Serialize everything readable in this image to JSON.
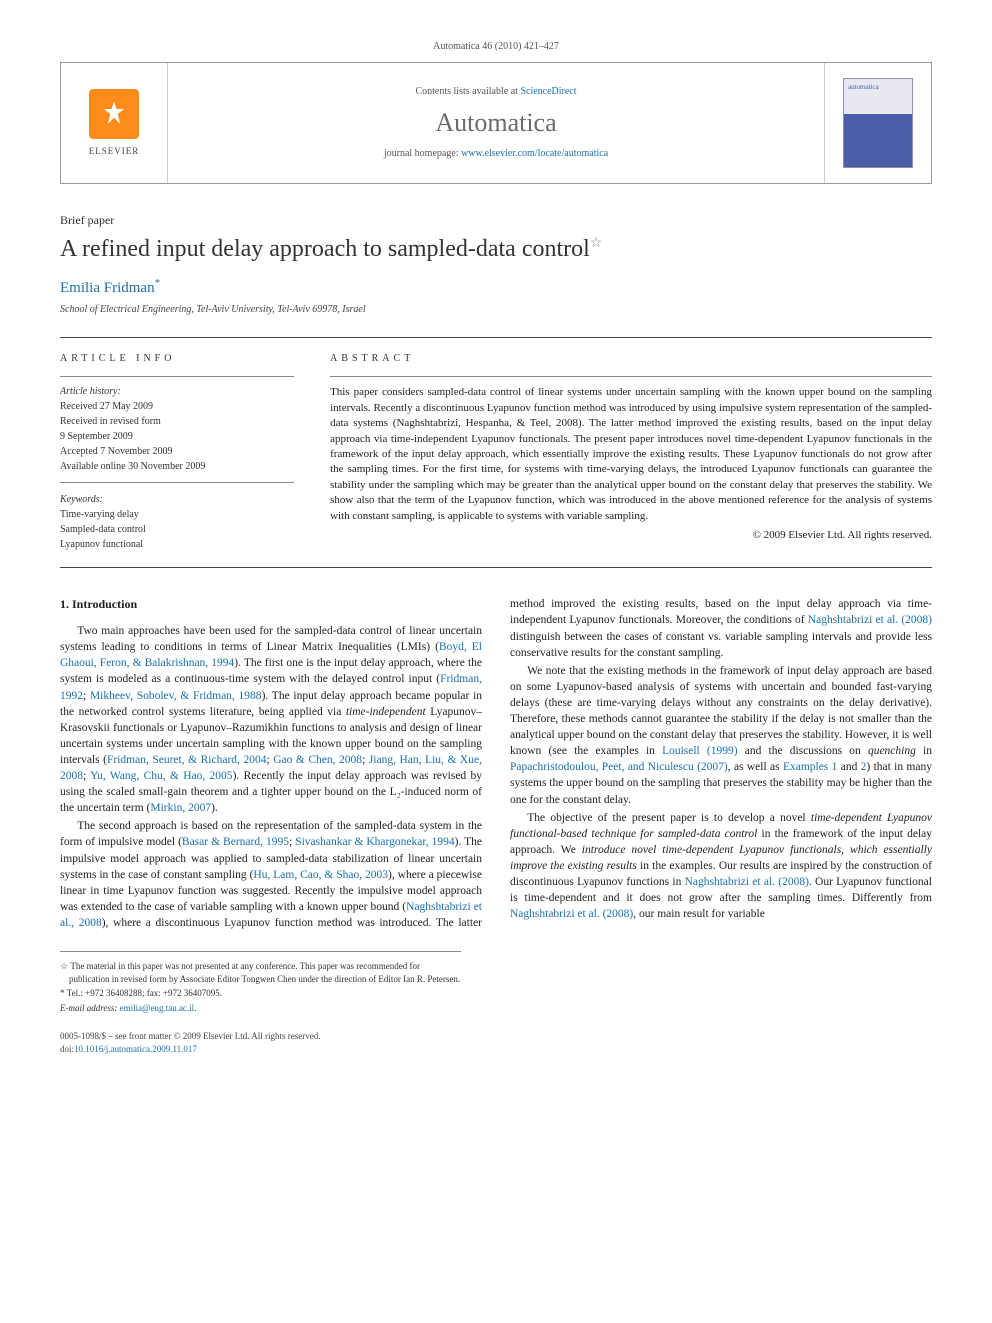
{
  "header": {
    "citation": "Automatica 46 (2010) 421–427"
  },
  "journal_box": {
    "publisher": "ELSEVIER",
    "contents_prefix": "Contents lists available at ",
    "contents_link": "ScienceDirect",
    "journal_name": "Automatica",
    "homepage_prefix": "journal homepage: ",
    "homepage_link": "www.elsevier.com/locate/automatica",
    "cover_label": "automatica"
  },
  "paper": {
    "type": "Brief paper",
    "title": "A refined input delay approach to sampled-data control",
    "title_marker": "☆",
    "author": "Emilia Fridman",
    "author_marker": "*",
    "affiliation": "School of Electrical Engineering, Tel-Aviv University, Tel-Aviv 69978, Israel"
  },
  "article_info": {
    "label": "ARTICLE INFO",
    "history_label": "Article history:",
    "history": [
      "Received 27 May 2009",
      "Received in revised form",
      "9 September 2009",
      "Accepted 7 November 2009",
      "Available online 30 November 2009"
    ],
    "keywords_label": "Keywords:",
    "keywords": [
      "Time-varying delay",
      "Sampled-data control",
      "Lyapunov functional"
    ]
  },
  "abstract": {
    "label": "ABSTRACT",
    "text": "This paper considers sampled-data control of linear systems under uncertain sampling with the known upper bound on the sampling intervals. Recently a discontinuous Lyapunov function method was introduced by using impulsive system representation of the sampled-data systems (Naghshtabrizi, Hespanha, & Teel, 2008). The latter method improved the existing results, based on the input delay approach via time-independent Lyapunov functionals. The present paper introduces novel time-dependent Lyapunov functionals in the framework of the input delay approach, which essentially improve the existing results. These Lyapunov functionals do not grow after the sampling times. For the first time, for systems with time-varying delays, the introduced Lyapunov functionals can guarantee the stability under the sampling which may be greater than the analytical upper bound on the constant delay that preserves the stability. We show also that the term of the Lyapunov function, which was introduced in the above mentioned reference for the analysis of systems with constant sampling, is applicable to systems with variable sampling.",
    "copyright": "© 2009 Elsevier Ltd. All rights reserved."
  },
  "body": {
    "section1_title": "1. Introduction",
    "p1a": "Two main approaches have been used for the sampled-data control of linear uncertain systems leading to conditions in terms of Linear Matrix Inequalities (LMIs) (",
    "p1_ref1": "Boyd, El Ghaoui, Feron, & Balakrishnan, 1994",
    "p1b": "). The first one is the input delay approach, where the system is modeled as a continuous-time system with the delayed control input (",
    "p1_ref2": "Fridman, 1992",
    "p1c": "; ",
    "p1_ref3": "Mikheev, Sobolev, & Fridman, 1988",
    "p1d": "). The input delay approach became popular in the networked control systems literature, being applied via ",
    "p1_em1": "time-independent",
    "p1e": " Lyapunov–Krasovskii functionals or Lyapunov–Razumikhin functions to analysis and design of linear uncertain systems under uncertain sampling with the known upper bound on the sampling intervals (",
    "p1_ref4": "Fridman, Seuret, & Richard, 2004",
    "p1f": "; ",
    "p1_ref5": "Gao & Chen, 2008",
    "p1g": "; ",
    "p1_ref6": "Jiang, Han, Liu, & Xue, 2008",
    "p1h": "; ",
    "p1_ref7": "Yu, Wang, Chu, & Hao, 2005",
    "p1i": "). Recently the input delay approach was revised by using the scaled small-gain theorem and a tighter upper bound on the L₂-induced norm of the uncertain term (",
    "p1_ref8": "Mirkin, 2007",
    "p1j": ").",
    "p2a": "The second approach is based on the representation of the sampled-data system in the form of impulsive model (",
    "p2_ref1": "Basar & Bernard, 1995",
    "p2b": "; ",
    "p2_ref2": "Sivashankar & Khargonekar, 1994",
    "p2c": "). The impulsive model approach was applied to sampled-data stabilization of linear uncertain systems in the case of constant sampling (",
    "p2_ref3": "Hu, Lam, ",
    "p2_ref3b": "Cao, & Shao, 2003",
    "p2d": "), where a piecewise linear in time Lyapunov function was suggested. Recently the impulsive model approach was extended to the case of variable sampling with a known upper bound (",
    "p2_ref4": "Naghshtabrizi et al., 2008",
    "p2e": "), where a discontinuous Lyapunov function method was introduced. The latter method improved the existing results, based on the input delay approach via time-independent Lyapunov functionals. Moreover, the conditions of ",
    "p2_ref5": "Naghshtabrizi et al. (2008)",
    "p2f": " distinguish between the cases of constant vs. variable sampling intervals and provide less conservative results for the constant sampling.",
    "p3a": "We note that the existing methods in the framework of input delay approach are based on some Lyapunov-based analysis of systems with uncertain and bounded fast-varying delays (these are time-varying delays without any constraints on the delay derivative). Therefore, these methods cannot guarantee the stability if the delay is not smaller than the analytical upper bound on the constant delay that preserves the stability. However, it is well known (see the examples in ",
    "p3_ref1": "Louisell (1999)",
    "p3b": " and the discussions on ",
    "p3_em1": "quenching",
    "p3c": " in ",
    "p3_ref2": "Papachristodoulou, Peet, and Niculescu (2007)",
    "p3d": ", as well as ",
    "p3_ref3": "Examples 1",
    "p3e": " and ",
    "p3_ref4": "2",
    "p3f": ") that in many systems the upper bound on the sampling that preserves the stability may be higher than the one for the constant delay.",
    "p4a": "The objective of the present paper is to develop a novel ",
    "p4_em1": "time-dependent Lyapunov functional-based technique for sampled-data control",
    "p4b": " in the framework of the input delay approach. We ",
    "p4_em2": "introduce novel time-dependent Lyapunov functionals, which essentially improve the existing results",
    "p4c": " in the examples. Our results are inspired by the construction of discontinuous Lyapunov functions in ",
    "p4_ref1": "Naghshtabrizi et al. (2008)",
    "p4d": ". Our Lyapunov functional is time-dependent and it does not grow after the sampling times. Differently from ",
    "p4_ref2": "Naghshtabrizi et al. (2008)",
    "p4e": ", our main result for variable"
  },
  "footnotes": {
    "fn1_marker": "☆",
    "fn1": "The material in this paper was not presented at any conference. This paper was recommended for publication in revised form by Associate Editor Tongwen Chen under the direction of Editor Ian R. Petersen.",
    "fn2_marker": "*",
    "fn2_label": "Tel.: +972 36408288; fax: +972 36407095.",
    "fn3_label": "E-mail address: ",
    "fn3_link": "emilia@eng.tau.ac.il",
    "fn3_suffix": "."
  },
  "footer": {
    "left": "0005-1098/$ – see front matter © 2009 Elsevier Ltd. All rights reserved.",
    "doi_prefix": "doi:",
    "doi_link": "10.1016/j.automatica.2009.11.017"
  }
}
